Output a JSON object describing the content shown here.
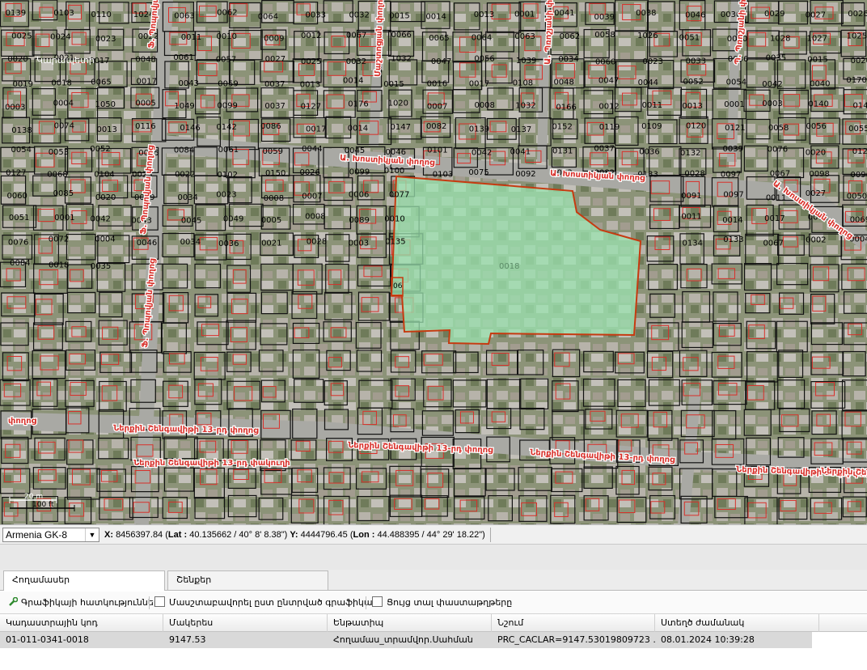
{
  "map": {
    "parcel_numbers": [
      "0139",
      "0103",
      "0110",
      "1024",
      "0063",
      "0062",
      "0064",
      "0033",
      "0032",
      "0015",
      "0014",
      "0013",
      "0001",
      "0041",
      "0039",
      "0038",
      "0046",
      "0030",
      "0029",
      "0027",
      "0026",
      "0025",
      "0024",
      "0023",
      "0022",
      "0011",
      "0010",
      "0009",
      "0012",
      "0067",
      "0066",
      "0065",
      "0064",
      "0063",
      "0062",
      "0058",
      "1026",
      "0051",
      "0060",
      "1028",
      "1027",
      "1025",
      "0020",
      "0021",
      "0017",
      "0048",
      "0061",
      "0057",
      "0027",
      "0025",
      "0032",
      "1032",
      "0047",
      "0056",
      "1039",
      "0034",
      "0060",
      "0023",
      "0033",
      "0036",
      "0035",
      "0015",
      "0020",
      "0019",
      "0018",
      "0065",
      "0017",
      "0043",
      "0059",
      "0037",
      "0013",
      "0014",
      "0015",
      "0016",
      "0017",
      "0108",
      "0048",
      "0047",
      "0044",
      "0052",
      "0054",
      "0042",
      "0040",
      "0170",
      "0003",
      "0004",
      "1050",
      "0005",
      "1049",
      "0099",
      "0037",
      "0127",
      "0176",
      "1020",
      "0007",
      "0008",
      "1032",
      "0166",
      "0012",
      "0011",
      "0013",
      "0001",
      "0003",
      "0140",
      "0144",
      "0138",
      "0074",
      "0013",
      "0116",
      "0146",
      "0142",
      "0086",
      "0017",
      "0014",
      "0147",
      "0082",
      "0139",
      "0137",
      "0152",
      "0119",
      "0109",
      "0120",
      "0121",
      "0058",
      "0056",
      "0055",
      "0054",
      "0053",
      "0052",
      "0085",
      "0084",
      "0061",
      "0059",
      "0044",
      "0045",
      "0046",
      "0101",
      "0042",
      "0041",
      "0131",
      "0037",
      "0036",
      "0132",
      "0039",
      "0076",
      "0020",
      "0126",
      "0127",
      "0068",
      "0104",
      "0023",
      "0022",
      "0102",
      "0150",
      "0026",
      "0099",
      "0100",
      "0103",
      "0075",
      "0092",
      "0093",
      "0082",
      "0133",
      "0028",
      "0097",
      "0067",
      "0098",
      "0096",
      "0060",
      "0085",
      "0020",
      "0019",
      "0034",
      "0023",
      "0008",
      "0007",
      "0006",
      "0077",
      "0091",
      "0097",
      "0011",
      "0027",
      "0050",
      "0051",
      "0001",
      "0042",
      "0043",
      "0045",
      "0049",
      "0005",
      "0008",
      "0089",
      "0010",
      "0011",
      "0014",
      "0017",
      "0071",
      "0069",
      "0076",
      "0072",
      "0004",
      "0046",
      "0034",
      "0036",
      "0021",
      "0028",
      "0003",
      "0135",
      "0134",
      "0133",
      "0067",
      "0002",
      "0004",
      "0084",
      "0018",
      "0035"
    ],
    "street_labels": [
      "Ա. Խոստիկյան փողոց",
      "Ա. Խոստիկյան փողոց",
      "Ա. Խոստիկյան փողոց",
      "Ներքին Շենգավիթի 13-րդ փողոց",
      "Ներքին Շենգավիթի 13-րդ փողոց",
      "Ներքին Շենգավիթի 13-րդ փողոց",
      "Ներքին Շենգավիթի 13-րդ փողոց",
      "Ներքին Շենգավիթի 13-րդ փողոց",
      "Ներքին Շենգավիթի 13-րդ փակուղի",
      "Ֆ. Պոպովյան փողոց",
      "Ֆ. Պոպովյան փողոց",
      "Ֆ. Պոպովյան փողոց",
      "Պ. Պռոշյանի փողոց",
      "Մաշտոցյան փողոց",
      "Ա. Պռոշյանի փողոց",
      "փողոց"
    ],
    "district_label": "Կարապետի",
    "selected_parcel": "0018",
    "parcel_06": "06",
    "scale": {
      "top": "20 m",
      "bottom": "100 ft"
    },
    "colors": {
      "parcel_line": "#d8302a",
      "selection_fill": "#9be3b0",
      "selection_stroke": "#c63a10",
      "lot_line": "#111111"
    }
  },
  "coordbar": {
    "crs": "Armenia GK-8",
    "x_label": "X:",
    "x_value": "8456397.84",
    "lat_label": "Lat :",
    "lat_value": "40.135662 / 40° 8' 8.38\"",
    "y_label": "Y:",
    "y_value": "4444796.45",
    "lon_label": "Lon :",
    "lon_value": "44.488395 / 44° 29' 18.22\""
  },
  "tabs": [
    "Հողամասեր",
    "Շենքեր"
  ],
  "toolbar": {
    "graphic_props": "Գրաֆիկայի հատկություններ",
    "scale_to_selected": "Մասշտաբավորել ըստ ընտրված գրաֆիկայի",
    "show_all_attrs": "Ցույց տալ փաստաթղթերը"
  },
  "table": {
    "headers": [
      "Կադաստրային կոդ",
      "Մակերես",
      "Ենթատիպ",
      "Նշում",
      "Ստեղծ ժամանակ"
    ],
    "rows": [
      [
        "01-011-0341-0018",
        "9147.53",
        "Հողամաս_տրամվոր.Սահման",
        "PRC_CACLAR=9147.53019809723 ...",
        "08.01.2024 10:39:28"
      ]
    ]
  }
}
